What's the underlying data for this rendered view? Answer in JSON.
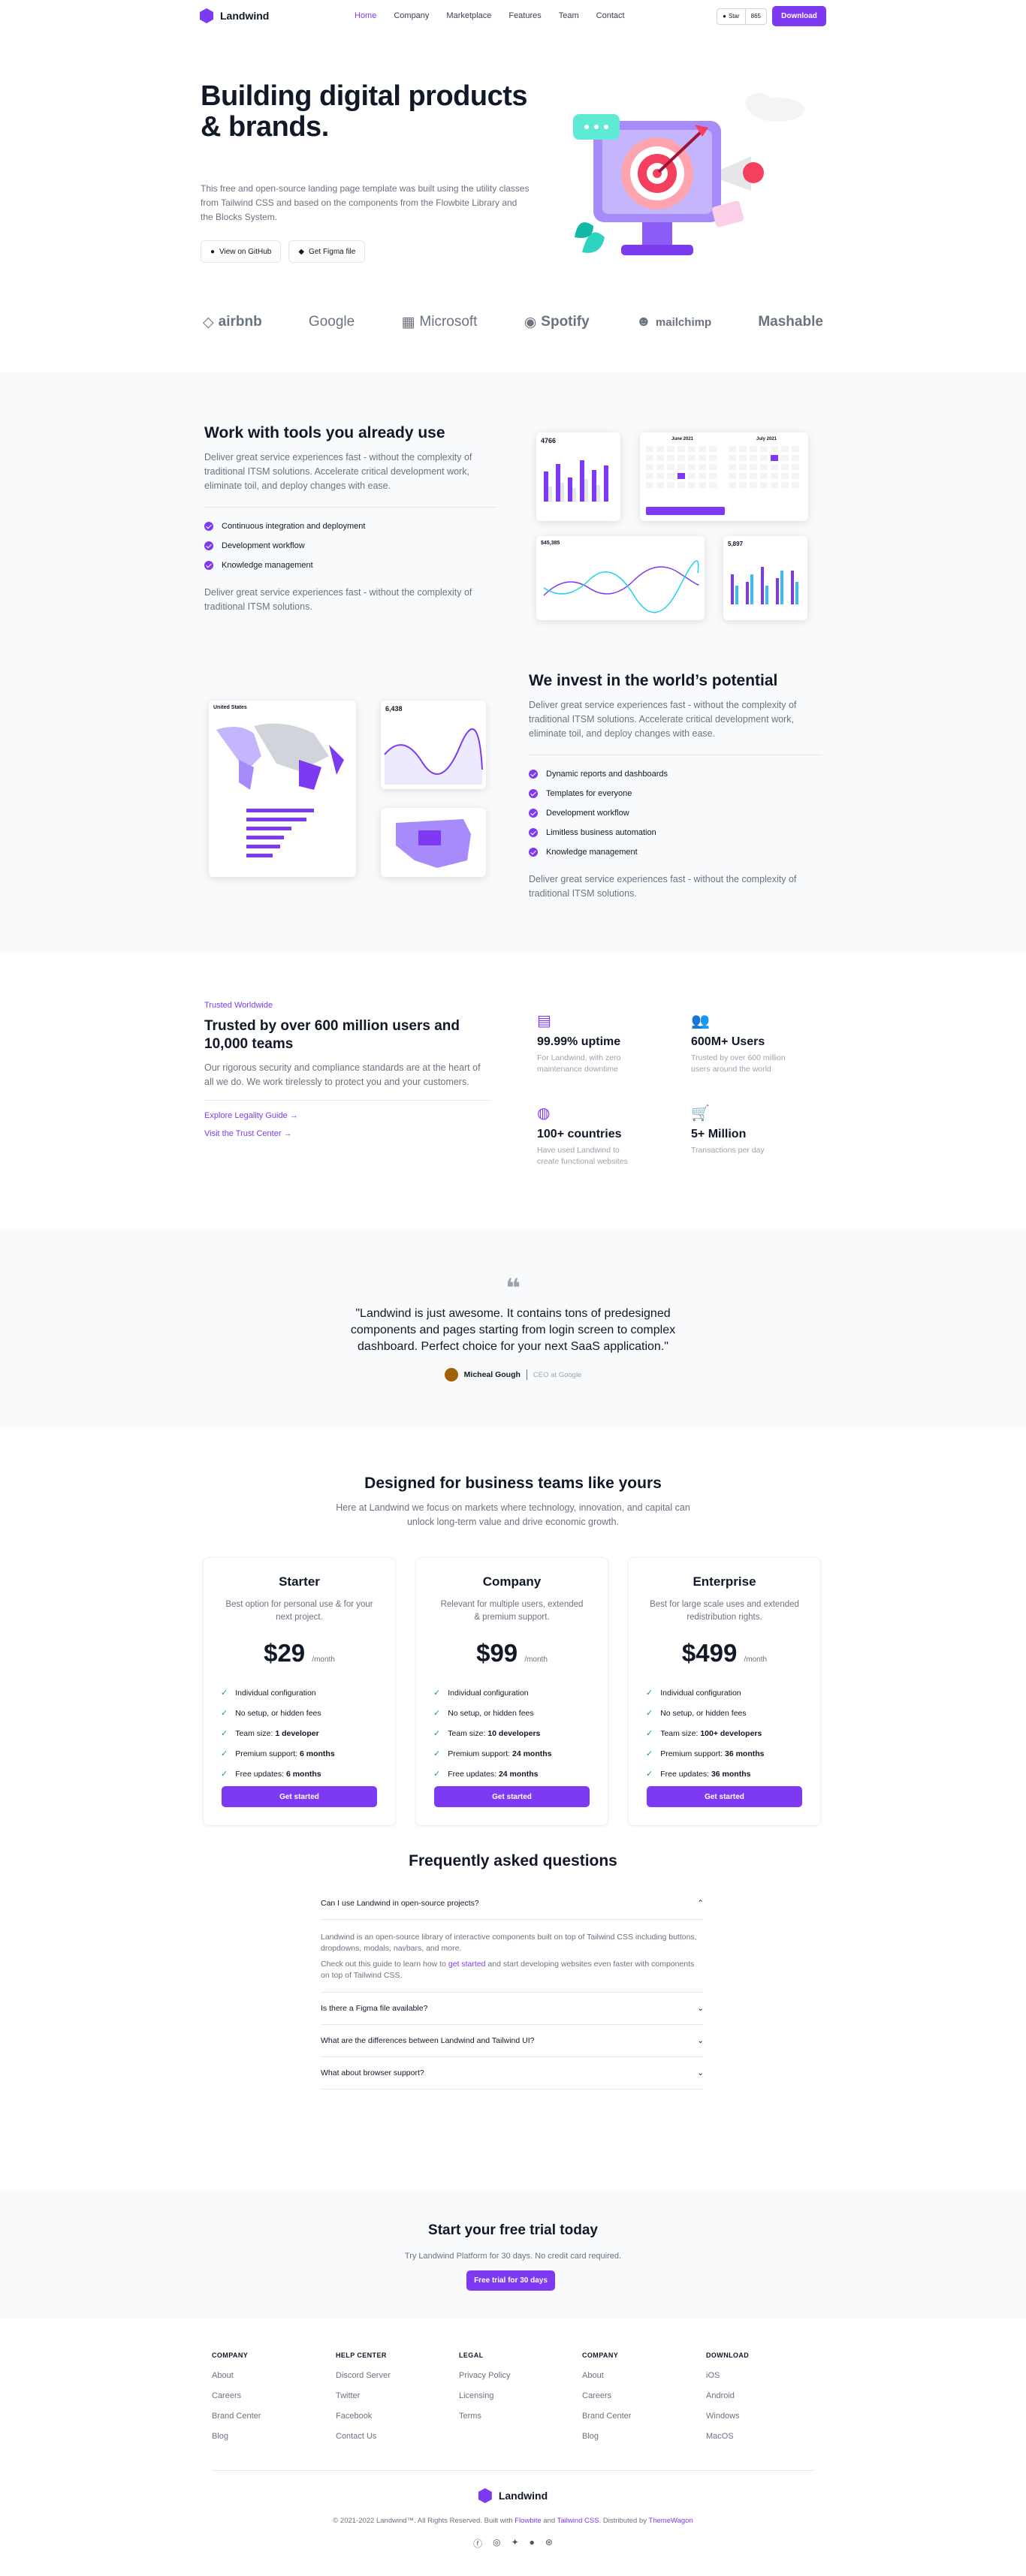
{
  "nav": {
    "brand": "Landwind",
    "items": [
      "Home",
      "Company",
      "Marketplace",
      "Features",
      "Team",
      "Contact"
    ],
    "star_label": "Star",
    "star_count": "865",
    "download": "Download"
  },
  "hero": {
    "title": "Building digital products & brands.",
    "desc": "This free and open-source landing page template was built using the utility classes from Tailwind CSS and based on the components from the Flowbite Library and the Blocks System.",
    "btn_github": "View on GitHub",
    "btn_figma": "Get Figma file"
  },
  "brands": [
    "airbnb",
    "Google",
    "Microsoft",
    "Spotify",
    "mailchimp",
    "Mashable"
  ],
  "tools": {
    "title": "Work with tools you already use",
    "desc": "Deliver great service experiences fast - without the complexity of traditional ITSM solutions. Accelerate critical development work, eliminate toil, and deploy changes with ease.",
    "items": [
      "Continuous integration and deployment",
      "Development workflow",
      "Knowledge management"
    ],
    "foot": "Deliver great service experiences fast - without the complexity of traditional ITSM solutions."
  },
  "invest": {
    "title": "We invest in the world’s potential",
    "desc": "Deliver great service experiences fast - without the complexity of traditional ITSM solutions. Accelerate critical development work, eliminate toil, and deploy changes with ease.",
    "items": [
      "Dynamic reports and dashboards",
      "Templates for everyone",
      "Development workflow",
      "Limitless business automation",
      "Knowledge management"
    ],
    "foot": "Deliver great service experiences fast - without the complexity of traditional ITSM solutions."
  },
  "trust": {
    "eyebrow": "Trusted Worldwide",
    "title": "Trusted by over 600 million users and 10,000 teams",
    "desc": "Our rigorous security and compliance standards are at the heart of all we do. We work tirelessly to protect you and your customers.",
    "link1": "Explore Legality Guide",
    "link2": "Visit the Trust Center",
    "stats": [
      {
        "t": "99.99% uptime",
        "d": "For Landwind, with zero maintenance downtime"
      },
      {
        "t": "600M+ Users",
        "d": "Trusted by over 600 million users around the world"
      },
      {
        "t": "100+ countries",
        "d": "Have used Landwind to create functional websites"
      },
      {
        "t": "5+ Million",
        "d": "Transactions per day"
      }
    ]
  },
  "testimonial": {
    "quote": "\"Landwind is just awesome. It contains tons of predesigned components and pages starting from login screen to complex dashboard. Perfect choice for your next SaaS application.\"",
    "name": "Micheal Gough",
    "role": "CEO at Google"
  },
  "pricing": {
    "title": "Designed for business teams like yours",
    "desc": "Here at Landwind we focus on markets where technology, innovation, and capital can unlock long-term value and drive economic growth.",
    "per": "/month",
    "cta": "Get started",
    "plans": [
      {
        "name": "Starter",
        "desc": "Best option for personal use & for your next project.",
        "price": "$29",
        "f": [
          "Individual configuration",
          "No setup, or hidden fees",
          "Team size: ",
          "Premium support: ",
          "Free updates: "
        ],
        "b": [
          "",
          "",
          "1 developer",
          "6 months",
          "6 months"
        ]
      },
      {
        "name": "Company",
        "desc": "Relevant for multiple users, extended & premium support.",
        "price": "$99",
        "f": [
          "Individual configuration",
          "No setup, or hidden fees",
          "Team size: ",
          "Premium support: ",
          "Free updates: "
        ],
        "b": [
          "",
          "",
          "10 developers",
          "24 months",
          "24 months"
        ]
      },
      {
        "name": "Enterprise",
        "desc": "Best for large scale uses and extended redistribution rights.",
        "price": "$499",
        "f": [
          "Individual configuration",
          "No setup, or hidden fees",
          "Team size: ",
          "Premium support: ",
          "Free updates: "
        ],
        "b": [
          "",
          "",
          "100+ developers",
          "36 months",
          "36 months"
        ]
      }
    ]
  },
  "faq": {
    "title": "Frequently asked questions",
    "q1": "Can I use Landwind in open-source projects?",
    "a1": "Landwind is an open-source library of interactive components built on top of Tailwind CSS including buttons, dropdowns, modals, navbars, and more.",
    "a2a": "Check out this guide to learn how to ",
    "a2link": "get started",
    "a2b": " and start developing websites even faster with components on top of Tailwind CSS.",
    "q2": "Is there a Figma file available?",
    "q3": "What are the differences between Landwind and Tailwind UI?",
    "q4": "What about browser support?"
  },
  "cta": {
    "title": "Start your free trial today",
    "desc": "Try Landwind Platform for 30 days. No credit card required.",
    "btn": "Free trial for 30 days"
  },
  "footer": {
    "cols": [
      {
        "h": "COMPANY",
        "l": [
          "About",
          "Careers",
          "Brand Center",
          "Blog"
        ]
      },
      {
        "h": "HELP CENTER",
        "l": [
          "Discord Server",
          "Twitter",
          "Facebook",
          "Contact Us"
        ]
      },
      {
        "h": "LEGAL",
        "l": [
          "Privacy Policy",
          "Licensing",
          "Terms"
        ]
      },
      {
        "h": "COMPANY",
        "l": [
          "About",
          "Careers",
          "Brand Center",
          "Blog"
        ]
      },
      {
        "h": "DOWNLOAD",
        "l": [
          "iOS",
          "Android",
          "Windows",
          "MacOS"
        ]
      }
    ],
    "brand": "Landwind",
    "copy_a": "© 2021-2022 Landwind™. All Rights Reserved. Built with ",
    "flowbite": "Flowbite",
    "and": " and ",
    "tailwind": "Tailwind CSS",
    "dist": ". Distributed by ",
    "themewagon": "ThemeWagon"
  },
  "mock": {
    "c1_value": "4766",
    "c2_month": "June 2021",
    "c2_month2": "July 2021",
    "c3_value": "$45,385",
    "c4_value": "5,897",
    "map_title": "United States",
    "m2_value": "6,438"
  }
}
